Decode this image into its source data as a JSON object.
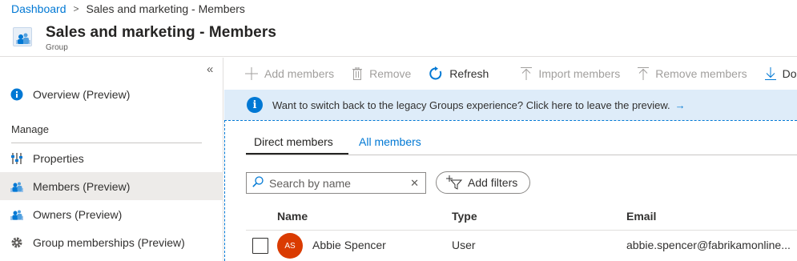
{
  "breadcrumb": {
    "root": "Dashboard",
    "separator": ">",
    "current": "Sales and marketing - Members"
  },
  "header": {
    "title": "Sales and marketing - Members",
    "subtitle": "Group",
    "icon": "group-icon"
  },
  "sidebar": {
    "collapse": "«",
    "items": [
      {
        "label": "Overview (Preview)",
        "icon": "info-icon"
      },
      {
        "label": "Properties",
        "icon": "properties-icon"
      },
      {
        "label": "Members (Preview)",
        "icon": "members-icon",
        "active": true
      },
      {
        "label": "Owners (Preview)",
        "icon": "owners-icon"
      },
      {
        "label": "Group memberships (Preview)",
        "icon": "gear-icon"
      }
    ],
    "section_manage": "Manage"
  },
  "toolbar": {
    "add_members": "Add members",
    "remove": "Remove",
    "refresh": "Refresh",
    "import_members": "Import members",
    "remove_members": "Remove members",
    "download": "Do"
  },
  "banner": {
    "text": "Want to switch back to the legacy Groups experience? Click here to leave the preview.",
    "arrow": "→"
  },
  "tabs": [
    {
      "label": "Direct members",
      "active": true
    },
    {
      "label": "All members",
      "active": false
    }
  ],
  "search": {
    "placeholder": "Search by name",
    "value": ""
  },
  "filters": {
    "label": "Add filters"
  },
  "table": {
    "columns": {
      "name": "Name",
      "type": "Type",
      "email": "Email"
    },
    "rows": [
      {
        "initials": "AS",
        "name": "Abbie Spencer",
        "type": "User",
        "email": "abbie.spencer@fabrikamonline..."
      }
    ]
  },
  "colors": {
    "accent": "#0078d4",
    "banner_bg": "#deecf9",
    "avatar": "#da3b01",
    "active_nav": "#edebe9"
  }
}
